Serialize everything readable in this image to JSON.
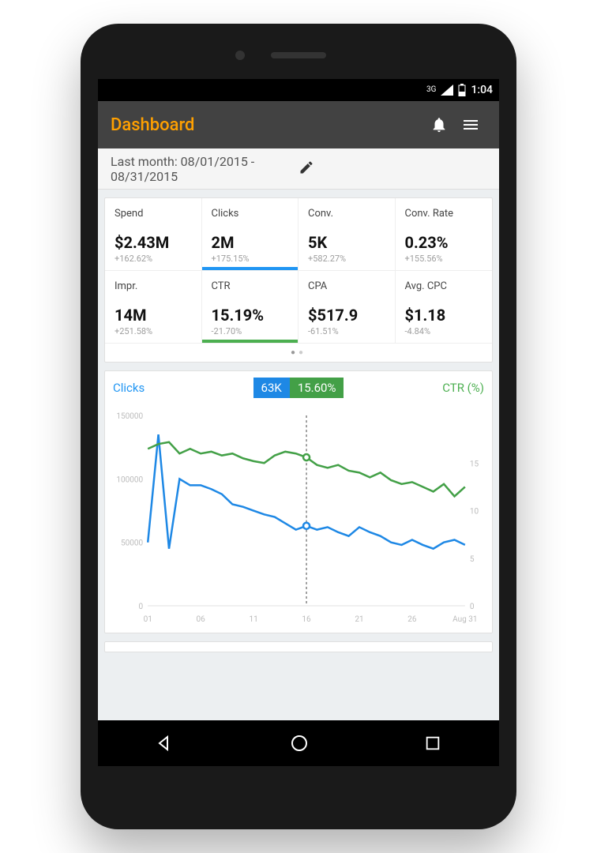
{
  "statusbar": {
    "network": "3G",
    "time": "1:04"
  },
  "header": {
    "title": "Dashboard"
  },
  "daterange": {
    "text": "Last month: 08/01/2015 - 08/31/2015"
  },
  "metrics": [
    {
      "label": "Spend",
      "value": "$2.43M",
      "delta": "+162.62%",
      "bar": ""
    },
    {
      "label": "Clicks",
      "value": "2M",
      "delta": "+175.15%",
      "bar": "blue"
    },
    {
      "label": "Conv.",
      "value": "5K",
      "delta": "+582.27%",
      "bar": ""
    },
    {
      "label": "Conv. Rate",
      "value": "0.23%",
      "delta": "+155.56%",
      "bar": ""
    },
    {
      "label": "Impr.",
      "value": "14M",
      "delta": "+251.58%",
      "bar": ""
    },
    {
      "label": "CTR",
      "value": "15.19%",
      "delta": "-21.70%",
      "bar": "green"
    },
    {
      "label": "CPA",
      "value": "$517.9",
      "delta": "-61.51%",
      "bar": ""
    },
    {
      "label": "Avg. CPC",
      "value": "$1.18",
      "delta": "-4.84%",
      "bar": ""
    }
  ],
  "chart": {
    "left_label": "Clicks",
    "right_label": "CTR (%)",
    "badge_left": "63K",
    "badge_right": "15.60%"
  },
  "chart_data": {
    "type": "line",
    "x": [
      1,
      2,
      3,
      4,
      5,
      6,
      7,
      8,
      9,
      10,
      11,
      12,
      13,
      14,
      15,
      16,
      17,
      18,
      19,
      20,
      21,
      22,
      23,
      24,
      25,
      26,
      27,
      28,
      29,
      30,
      31
    ],
    "x_tick_labels": [
      "01",
      "06",
      "11",
      "16",
      "21",
      "26",
      "Aug 31"
    ],
    "cursor_x": 16,
    "series": [
      {
        "name": "Clicks",
        "axis": "left",
        "color": "#1e88e5",
        "ylim": [
          0,
          150000
        ],
        "y_ticks": [
          0,
          50000,
          100000,
          150000
        ],
        "values": [
          50000,
          135000,
          45000,
          100000,
          95000,
          95000,
          92000,
          88000,
          80000,
          78000,
          75000,
          72000,
          70000,
          65000,
          60000,
          63000,
          60000,
          62000,
          58000,
          55000,
          62000,
          58000,
          55000,
          50000,
          48000,
          52000,
          48000,
          45000,
          50000,
          52000,
          48000
        ]
      },
      {
        "name": "CTR (%)",
        "axis": "right",
        "color": "#43a047",
        "ylim": [
          0,
          20
        ],
        "y_ticks": [
          0,
          5,
          10,
          15
        ],
        "values": [
          16.5,
          17.0,
          17.2,
          16.0,
          16.5,
          16.0,
          16.2,
          15.8,
          16.0,
          15.5,
          15.2,
          15.0,
          15.8,
          16.2,
          16.0,
          15.6,
          14.8,
          14.5,
          14.8,
          14.2,
          14.0,
          13.5,
          14.0,
          13.2,
          12.8,
          13.0,
          12.5,
          12.0,
          12.8,
          11.5,
          12.5
        ]
      }
    ]
  }
}
